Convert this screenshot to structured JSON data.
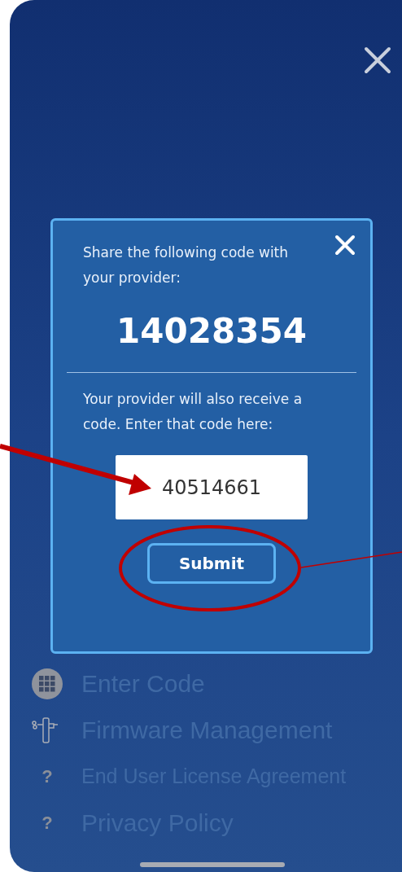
{
  "modal": {
    "share_text": "Share the following code with your provider:",
    "code": "14028354",
    "receive_text": "Your provider will also receive a code. Enter that code here:",
    "input_value": "40514661",
    "submit_label": "Submit"
  },
  "menu": [
    {
      "kind": "grid",
      "label": "Enter Code"
    },
    {
      "kind": "device",
      "label": "Firmware Management"
    },
    {
      "kind": "help",
      "icon": "?",
      "label": "End User License Agreement"
    },
    {
      "kind": "help",
      "icon": "?",
      "label": "Privacy Policy"
    }
  ]
}
